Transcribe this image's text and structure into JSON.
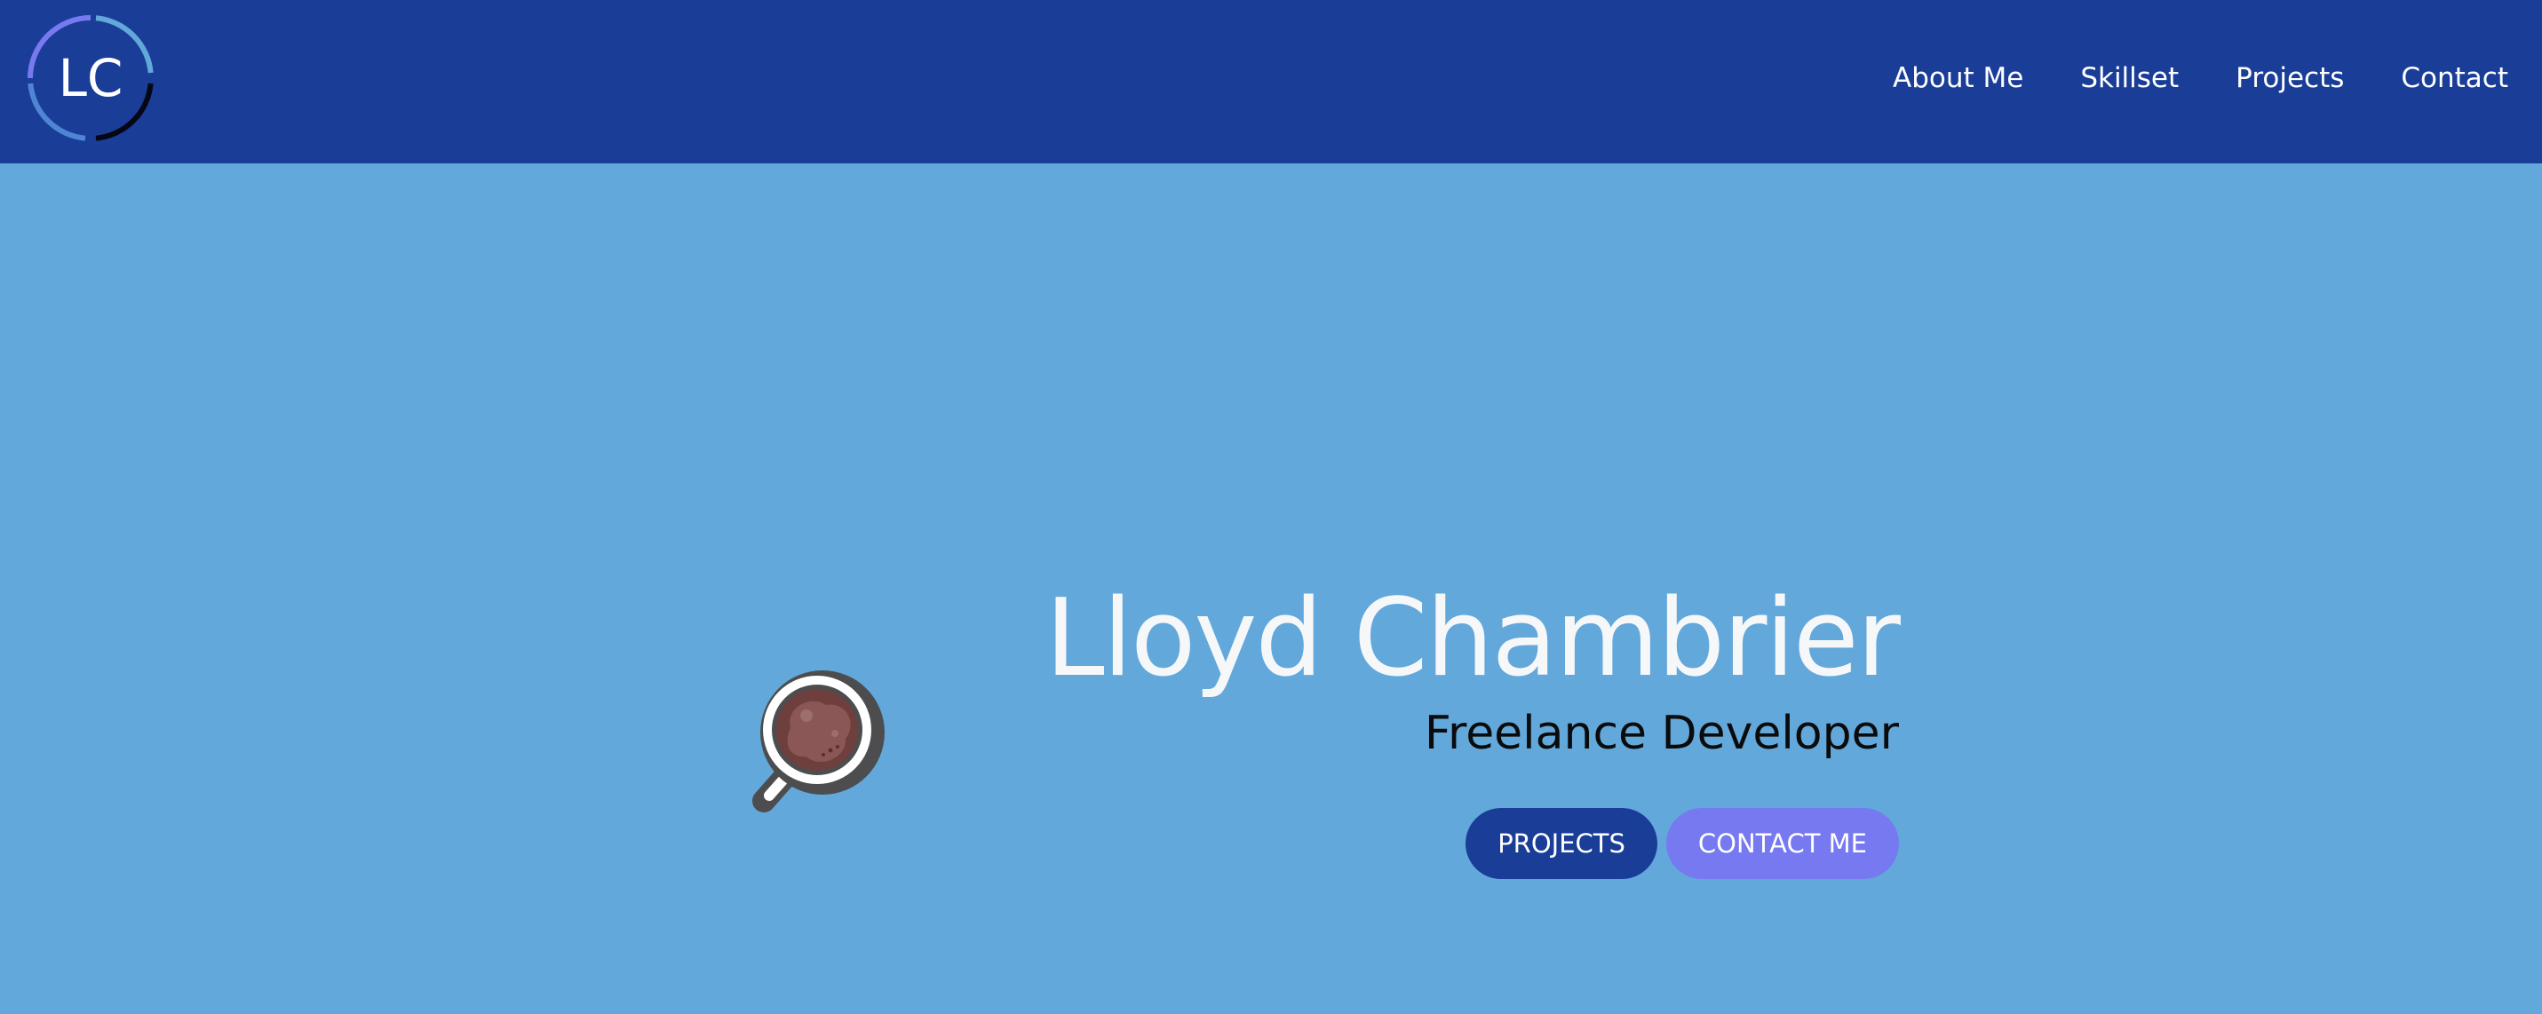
{
  "logo": {
    "text": "LC",
    "icon": "lc-monogram-logo"
  },
  "nav": {
    "items": [
      {
        "label": "About Me"
      },
      {
        "label": "Skillset"
      },
      {
        "label": "Projects"
      },
      {
        "label": "Contact"
      }
    ]
  },
  "hero": {
    "name": "Lloyd Chambrier",
    "role": "Freelance Developer",
    "projects_button": "PROJECTS",
    "contact_button": "CONTACT ME",
    "illustration_icon": "coffee-mug-icon"
  },
  "colors": {
    "header_bg": "#1a3d98",
    "page_bg": "#62a8db",
    "primary_button": "#1a3d98",
    "secondary_button": "#7779f1"
  }
}
